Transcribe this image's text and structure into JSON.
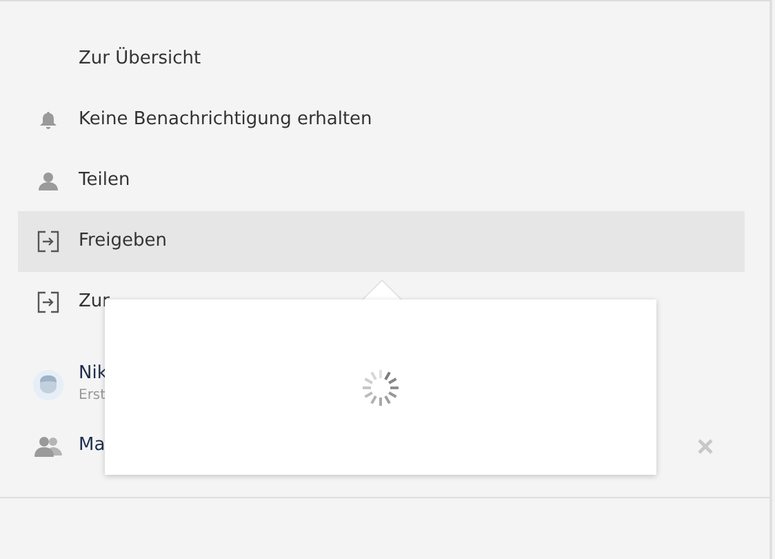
{
  "menu": [
    {
      "label": "Zur Übersicht",
      "kind": "plain",
      "selected": false
    },
    {
      "label": "Keine Benachrichtigung erhalten",
      "kind": "notify",
      "selected": false
    },
    {
      "label": "Teilen",
      "kind": "share",
      "selected": false
    },
    {
      "label": "Freigeben",
      "kind": "release",
      "selected": true
    },
    {
      "label": "Zur",
      "kind": "release",
      "selected": false
    }
  ],
  "participants": [
    {
      "kind": "person",
      "name": "Nik",
      "subtitle": "Erst"
    },
    {
      "kind": "group",
      "name": "Ma",
      "removable": true
    }
  ],
  "popover": {
    "loading": true
  }
}
